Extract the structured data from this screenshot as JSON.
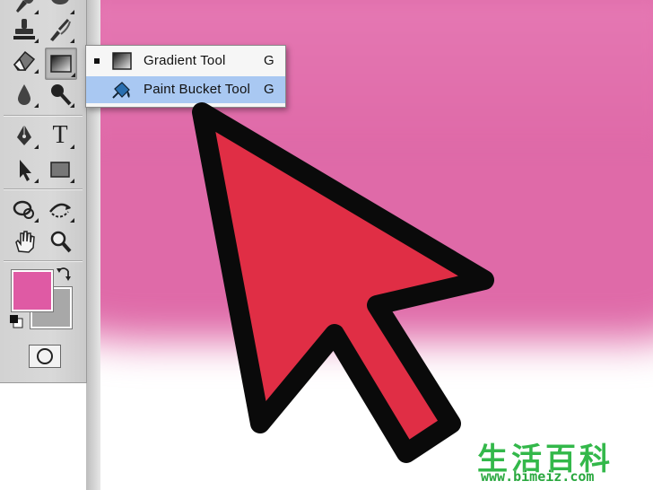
{
  "flyout": {
    "items": [
      {
        "label": "Gradient Tool",
        "shortcut": "G",
        "icon": "gradient-icon",
        "active": true
      },
      {
        "label": "Paint Bucket Tool",
        "shortcut": "G",
        "icon": "paint-bucket-icon",
        "highlighted": true
      }
    ]
  },
  "toolbar": {
    "tools": [
      {
        "name": "brush-tool",
        "icon": "brush-icon"
      },
      {
        "name": "history-brush-tool",
        "icon": "history-brush-icon"
      },
      {
        "name": "clone-stamp-tool",
        "icon": "stamp-icon"
      },
      {
        "name": "art-history-tool",
        "icon": "art-history-icon"
      },
      {
        "name": "eraser-tool",
        "icon": "eraser-icon"
      },
      {
        "name": "gradient-tool",
        "icon": "gradient-icon"
      },
      {
        "name": "blur-tool",
        "icon": "droplet-icon"
      },
      {
        "name": "dodge-tool",
        "icon": "dodge-icon"
      },
      {
        "name": "pen-tool",
        "icon": "pen-icon"
      },
      {
        "name": "type-tool",
        "icon": "type-icon"
      },
      {
        "name": "path-selection-tool",
        "icon": "arrow-pointer-icon"
      },
      {
        "name": "rectangle-tool",
        "icon": "rectangle-icon"
      },
      {
        "name": "3d-rotate-tool",
        "icon": "3d-rotate-icon"
      },
      {
        "name": "3d-orbit-tool",
        "icon": "3d-orbit-icon"
      },
      {
        "name": "hand-tool",
        "icon": "hand-icon"
      },
      {
        "name": "zoom-tool",
        "icon": "magnifier-icon"
      }
    ],
    "type_glyph": "T",
    "foreground_color": "#df5aa4",
    "background_color": "#a8a8a8"
  },
  "canvas": {
    "fill_color": "#df6aa8",
    "arrow_color": "#e02e45"
  },
  "watermark": {
    "text": "生活百科",
    "url": "www.bimeiz.com"
  }
}
